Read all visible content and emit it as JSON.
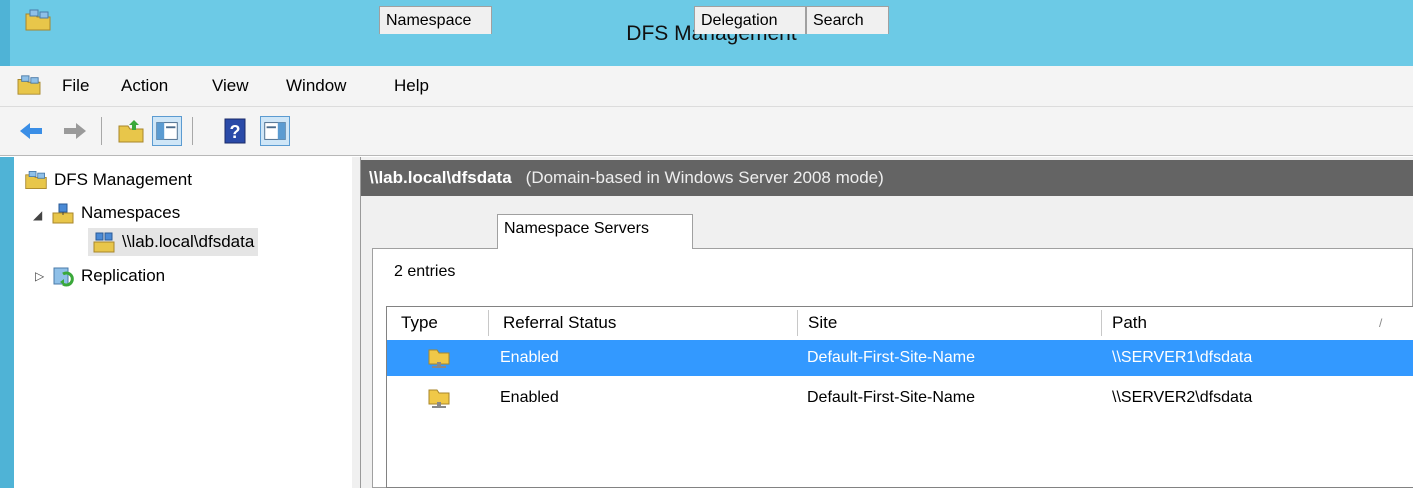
{
  "window": {
    "title": "DFS Management"
  },
  "menu": [
    "File",
    "Action",
    "View",
    "Window",
    "Help"
  ],
  "toolbar": {
    "buttons": [
      "back-icon",
      "forward-icon",
      "up-folder-icon",
      "show-hide-console-tree-icon",
      "help-icon",
      "show-hide-action-pane-icon"
    ]
  },
  "tree": {
    "root": "DFS Management",
    "namespaces": "Namespaces",
    "namespace_item": "\\\\lab.local\\dfsdata",
    "replication": "Replication"
  },
  "header": {
    "path": "\\\\lab.local\\dfsdata",
    "mode": "(Domain-based in Windows Server 2008 mode)"
  },
  "tabs": [
    "Namespace",
    "Namespace Servers",
    "Delegation",
    "Search"
  ],
  "active_tab": "Namespace Servers",
  "entries_label": "2 entries",
  "columns": [
    "Type",
    "Referral Status",
    "Site",
    "Path"
  ],
  "rows": [
    {
      "referral_status": "Enabled",
      "site": "Default-First-Site-Name",
      "path": "\\\\SERVER1\\dfsdata",
      "selected": true
    },
    {
      "referral_status": "Enabled",
      "site": "Default-First-Site-Name",
      "path": "\\\\SERVER2\\dfsdata",
      "selected": false
    }
  ],
  "colors": {
    "titlebar": "#6ccae6",
    "header": "#646464",
    "selection": "#3399ff"
  }
}
